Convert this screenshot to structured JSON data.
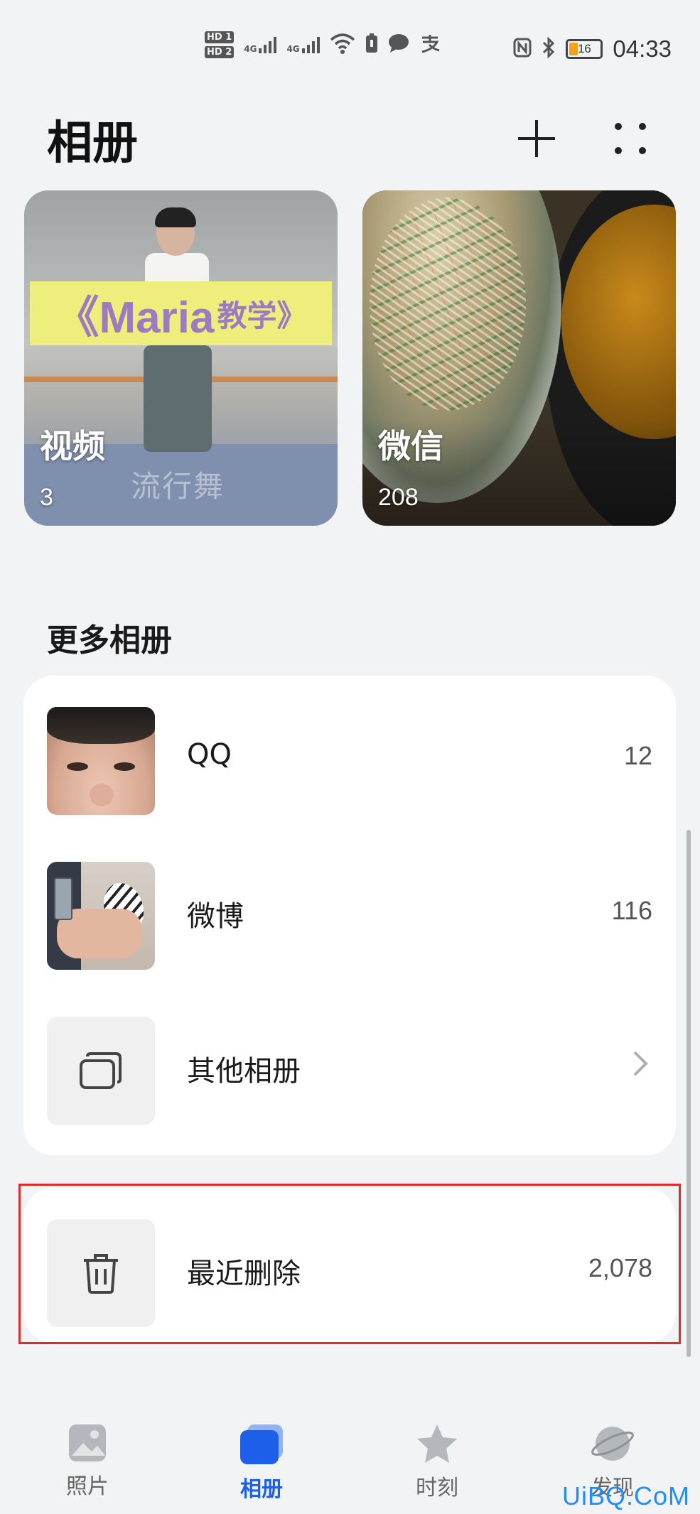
{
  "status_bar": {
    "hd1": "HD 1",
    "hd2": "HD 2",
    "signal1": "4G",
    "signal2": "4G",
    "battery": "16",
    "time": "04:33",
    "icons": [
      "wifi-icon",
      "sim-icon",
      "message-icon",
      "alipay-icon",
      "nfc-icon",
      "bluetooth-icon",
      "battery-icon"
    ]
  },
  "header": {
    "title": "相册",
    "add_icon": "plus-icon",
    "more_icon": "more-dots-icon"
  },
  "albums": [
    {
      "name": "视频",
      "count": "3",
      "banner_main": "《Maria",
      "banner_sub": "教学》",
      "watermark": "流行舞"
    },
    {
      "name": "微信",
      "count": "208"
    }
  ],
  "more_section": {
    "title": "更多相册",
    "items": [
      {
        "name": "QQ",
        "count": "12"
      },
      {
        "name": "微博",
        "count": "116"
      },
      {
        "name": "其他相册",
        "count": ""
      }
    ]
  },
  "recently_deleted": {
    "name": "最近删除",
    "count": "2,078"
  },
  "bottom_nav": {
    "items": [
      {
        "label": "照片",
        "icon": "photo-icon",
        "active": false
      },
      {
        "label": "相册",
        "icon": "album-icon",
        "active": true
      },
      {
        "label": "时刻",
        "icon": "star-icon",
        "active": false
      },
      {
        "label": "发现",
        "icon": "planet-icon",
        "active": false
      }
    ]
  },
  "colors": {
    "accent": "#1d5fe8",
    "background": "#f1f3f5",
    "highlight": "#e02b2b"
  },
  "watermark": "UiBQ.CoM"
}
